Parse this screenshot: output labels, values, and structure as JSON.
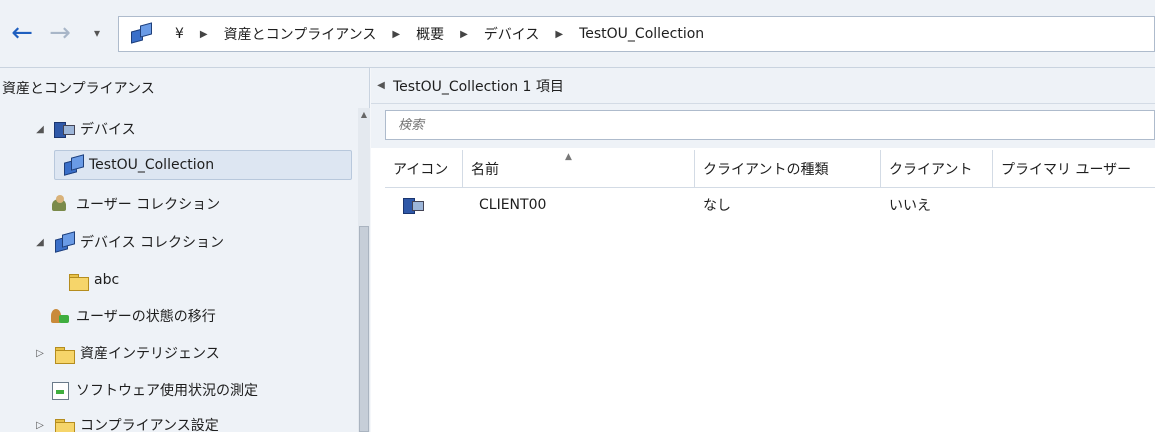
{
  "address_bar": {
    "back_icon": "arrow-left",
    "forward_icon": "arrow-right",
    "breadcrumbs": [
      "¥",
      "資産とコンプライアンス",
      "概要",
      "デバイス",
      "TestOU_Collection"
    ]
  },
  "left_pane": {
    "title": "資産とコンプライアンス",
    "tree": [
      {
        "label": "デバイス",
        "icon": "devices-icon",
        "expander": "expanded"
      },
      {
        "label": "TestOU_Collection",
        "icon": "collection-icon",
        "selected": true
      },
      {
        "label": "ユーザー コレクション",
        "icon": "user-collection-icon"
      },
      {
        "label": "デバイス コレクション",
        "icon": "device-collection-icon",
        "expander": "expanded"
      },
      {
        "label": "abc",
        "icon": "folder-icon"
      },
      {
        "label": "ユーザーの状態の移行",
        "icon": "user-state-migration-icon"
      },
      {
        "label": "資産インテリジェンス",
        "icon": "folder-icon",
        "expander": "collapsed"
      },
      {
        "label": "ソフトウェア使用状況の測定",
        "icon": "software-metering-icon"
      },
      {
        "label": "コンプライアンス設定",
        "icon": "folder-icon",
        "expander": "collapsed"
      }
    ]
  },
  "right_pane": {
    "title": "TestOU_Collection 1 項目",
    "search_placeholder": "検索",
    "columns": [
      "アイコン",
      "名前",
      "クライアントの種類",
      "クライアント",
      "プライマリ ユーザー"
    ],
    "rows": [
      {
        "icon": "device-icon",
        "name": "CLIENT00",
        "client_type": "なし",
        "client": "いいえ",
        "primary_user": ""
      }
    ]
  },
  "colors": {
    "accent": "#1f5fbf",
    "pane_bg": "#eef2f7",
    "selection": "#dde6f2"
  }
}
